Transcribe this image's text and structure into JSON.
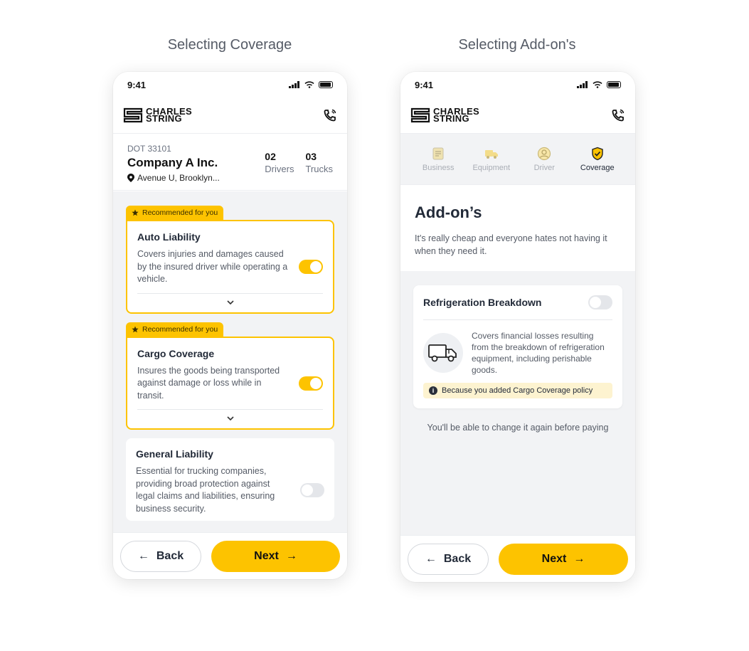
{
  "captions": {
    "left": "Selecting Coverage",
    "right": "Selecting Add-on's"
  },
  "status": {
    "time": "9:41"
  },
  "brand": {
    "line1": "CHARLES",
    "line2": "STRING"
  },
  "company": {
    "dot": "DOT 33101",
    "name": "Company A Inc.",
    "address": "Avenue U, Brooklyn...",
    "stats": [
      {
        "value": "02",
        "label": "Drivers"
      },
      {
        "value": "03",
        "label": "Trucks"
      }
    ]
  },
  "coverages": [
    {
      "tag": "Recommended for you",
      "title": "Auto Liability",
      "desc": "Covers injuries and damages caused by the insured driver while operating a vehicle.",
      "enabled": true
    },
    {
      "tag": "Recommended for you",
      "title": "Cargo Coverage",
      "desc": "Insures the goods being transported against damage or loss while in transit.",
      "enabled": true
    },
    {
      "title": "General Liability",
      "desc": "Essential for trucking companies, providing broad protection against legal claims and liabilities, ensuring business security.",
      "enabled": false
    }
  ],
  "footer": {
    "back": "Back",
    "next": "Next"
  },
  "steps": [
    {
      "label": "Business",
      "icon": "document-icon",
      "active": false
    },
    {
      "label": "Equipment",
      "icon": "truck-icon",
      "active": false
    },
    {
      "label": "Driver",
      "icon": "user-circle-icon",
      "active": false
    },
    {
      "label": "Coverage",
      "icon": "shield-check-icon",
      "active": true
    }
  ],
  "addons": {
    "title": "Add-on’s",
    "subtitle": "It's really cheap and everyone hates not having it when they need it.",
    "card": {
      "title": "Refrigeration Breakdown",
      "enabled": false,
      "desc": "Covers financial losses resulting from the breakdown of refrigeration equipment, including perishable goods.",
      "because": "Because you added Cargo Coverage policy"
    },
    "note": "You'll be able to change it again before paying"
  },
  "colors": {
    "accent": "#FDC300",
    "text": "#222A38",
    "muted": "#555B66",
    "background": "#F2F3F5"
  }
}
